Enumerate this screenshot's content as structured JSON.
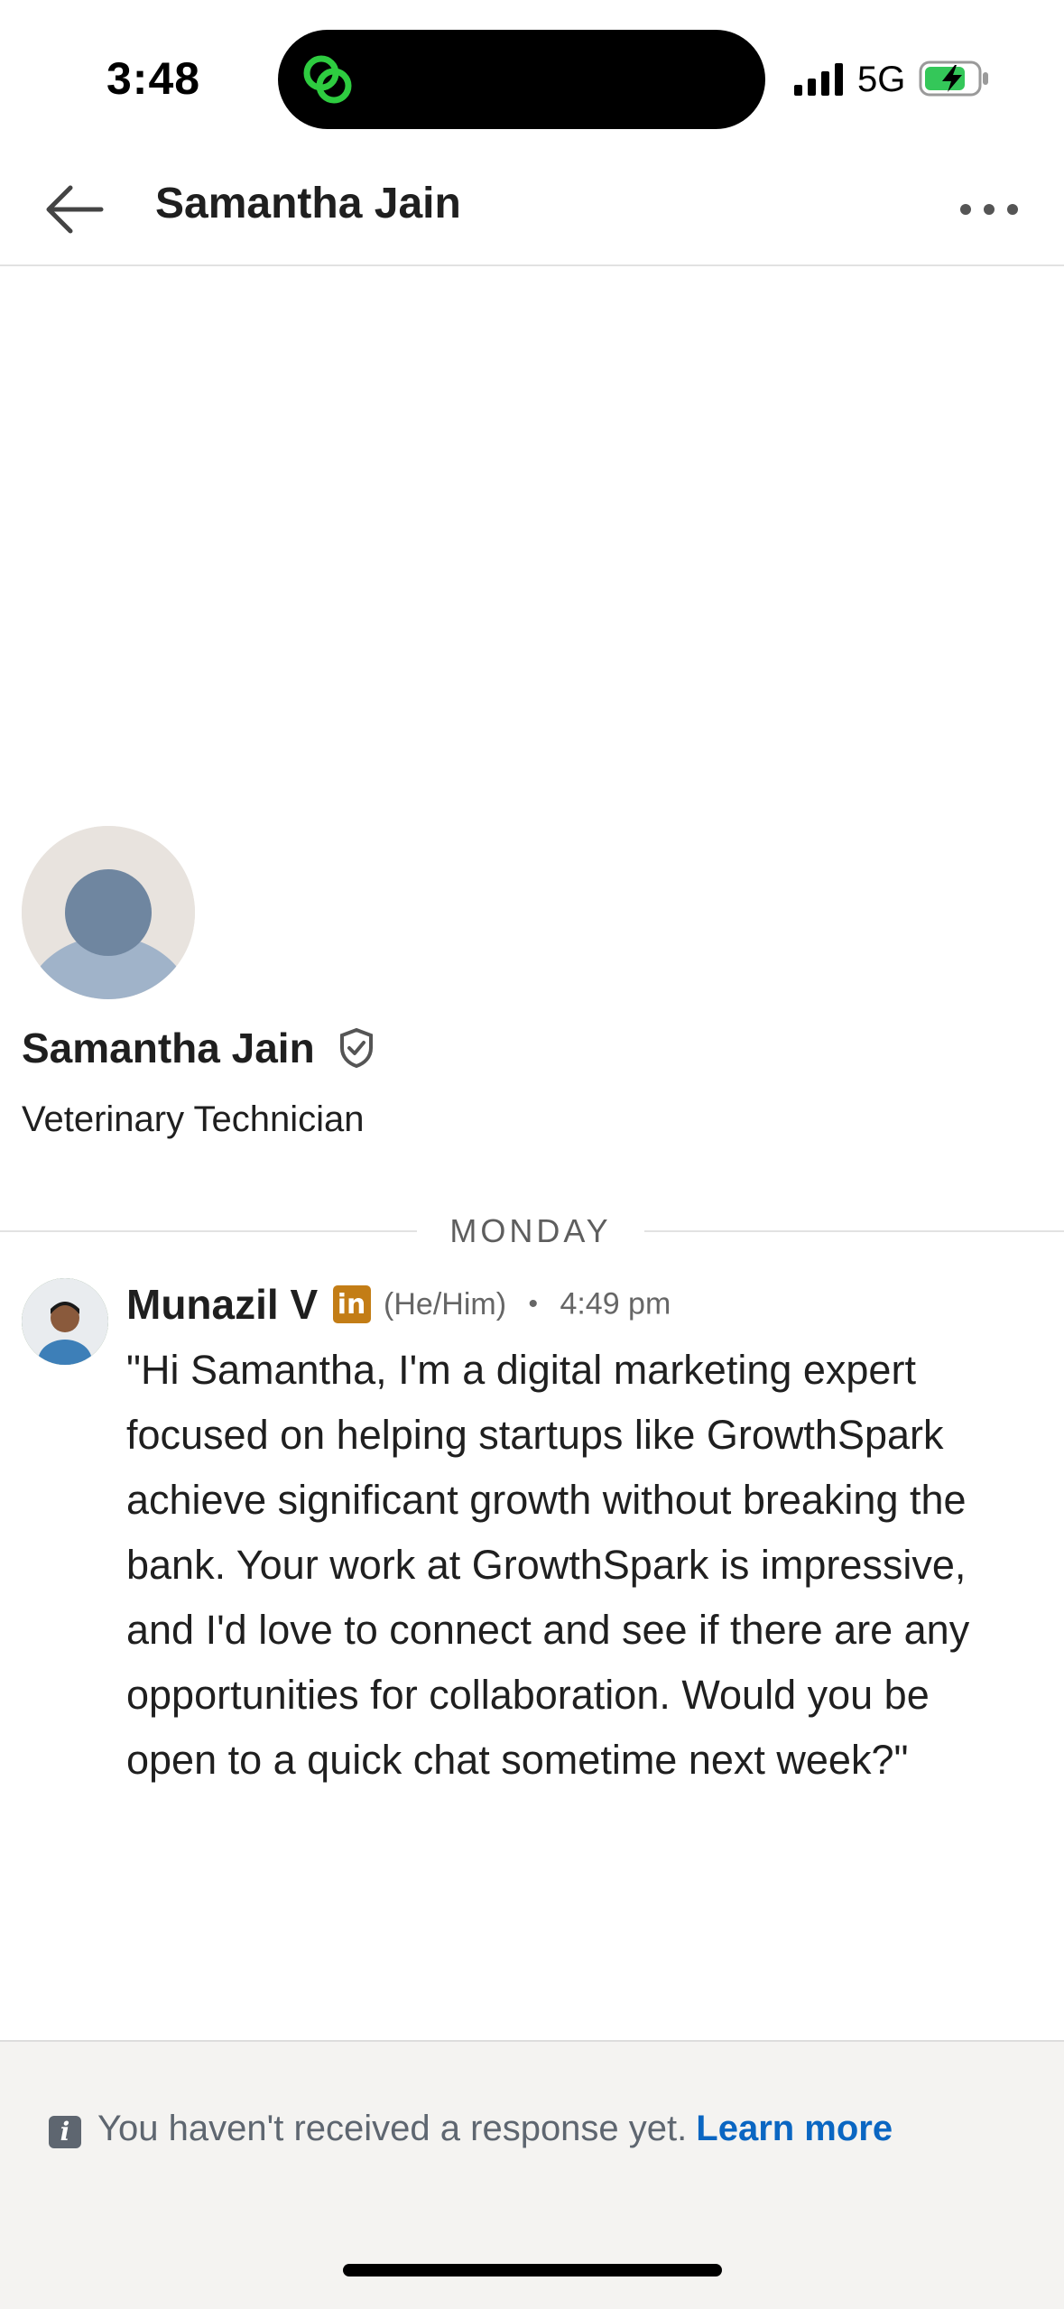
{
  "status_bar": {
    "time": "3:48",
    "network": "5G",
    "accent": "#2ecc40"
  },
  "header": {
    "title": "Samantha Jain",
    "back_icon": "arrow-left-icon",
    "more_icon": "more-horizontal-icon"
  },
  "profile": {
    "name": "Samantha Jain",
    "headline": "Veterinary Technician",
    "verified_icon": "verified-shield-icon"
  },
  "conversation": {
    "day_label": "MONDAY",
    "messages": [
      {
        "sender": "Munazil V",
        "badge": "in",
        "pronouns": "(He/Him)",
        "separator": "•",
        "time": "4:49 pm",
        "text": "\"Hi Samantha, I'm a digital marketing expert focused on helping startups like GrowthSpark achieve significant growth without breaking the bank.  Your work at GrowthSpark is impressive, and I'd love to connect and see if there are any opportunities for collaboration.  Would you be open to a quick chat sometime next week?\""
      }
    ]
  },
  "footer": {
    "info_icon": "i",
    "notice": "You haven't received a response yet.",
    "learn_more": "Learn more",
    "link_color": "#0a66c2"
  }
}
